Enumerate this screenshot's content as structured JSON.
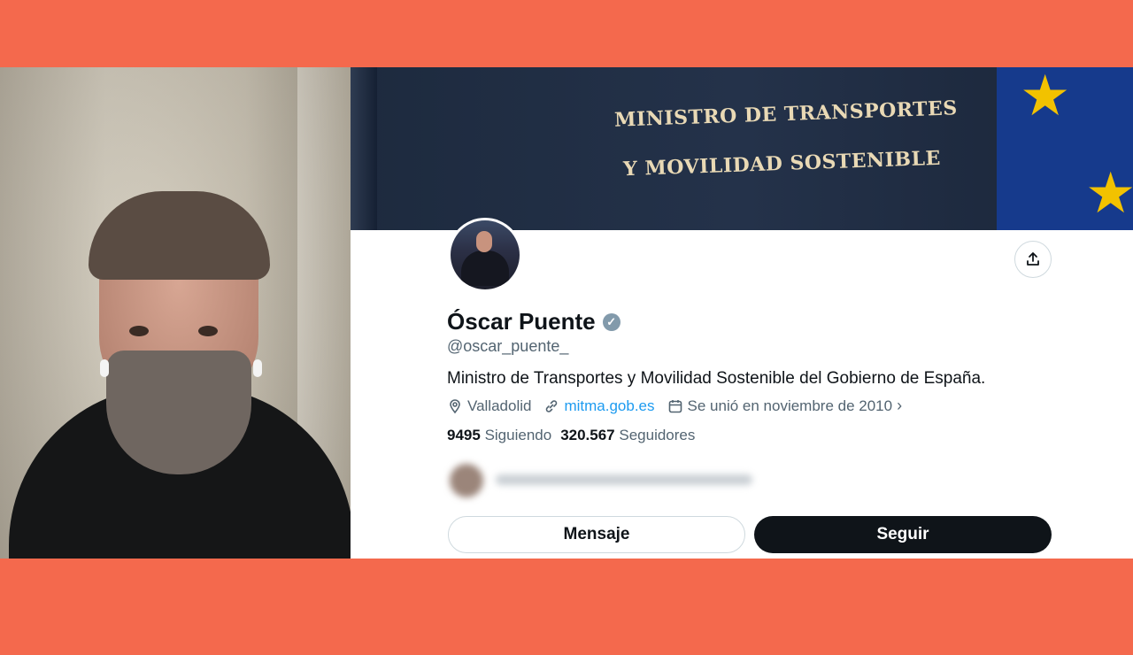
{
  "banner": {
    "line1": "MINISTRO DE TRANSPORTES",
    "line2": "Y MOVILIDAD SOSTENIBLE"
  },
  "profile": {
    "name": "Óscar Puente",
    "handle": "@oscar_puente_",
    "bio": "Ministro de Transportes y Movilidad Sostenible del Gobierno de España.",
    "location": "Valladolid",
    "website": "mitma.gob.es",
    "joined": "Se unió en noviembre de 2010",
    "following_count": "9495",
    "following_label": "Siguiendo",
    "followers_count": "320.567",
    "followers_label": "Seguidores"
  },
  "buttons": {
    "message": "Mensaje",
    "follow": "Seguir"
  },
  "colors": {
    "background": "#f4694d",
    "link": "#1d9bf0",
    "text": "#0f1419",
    "muted": "#536471"
  }
}
